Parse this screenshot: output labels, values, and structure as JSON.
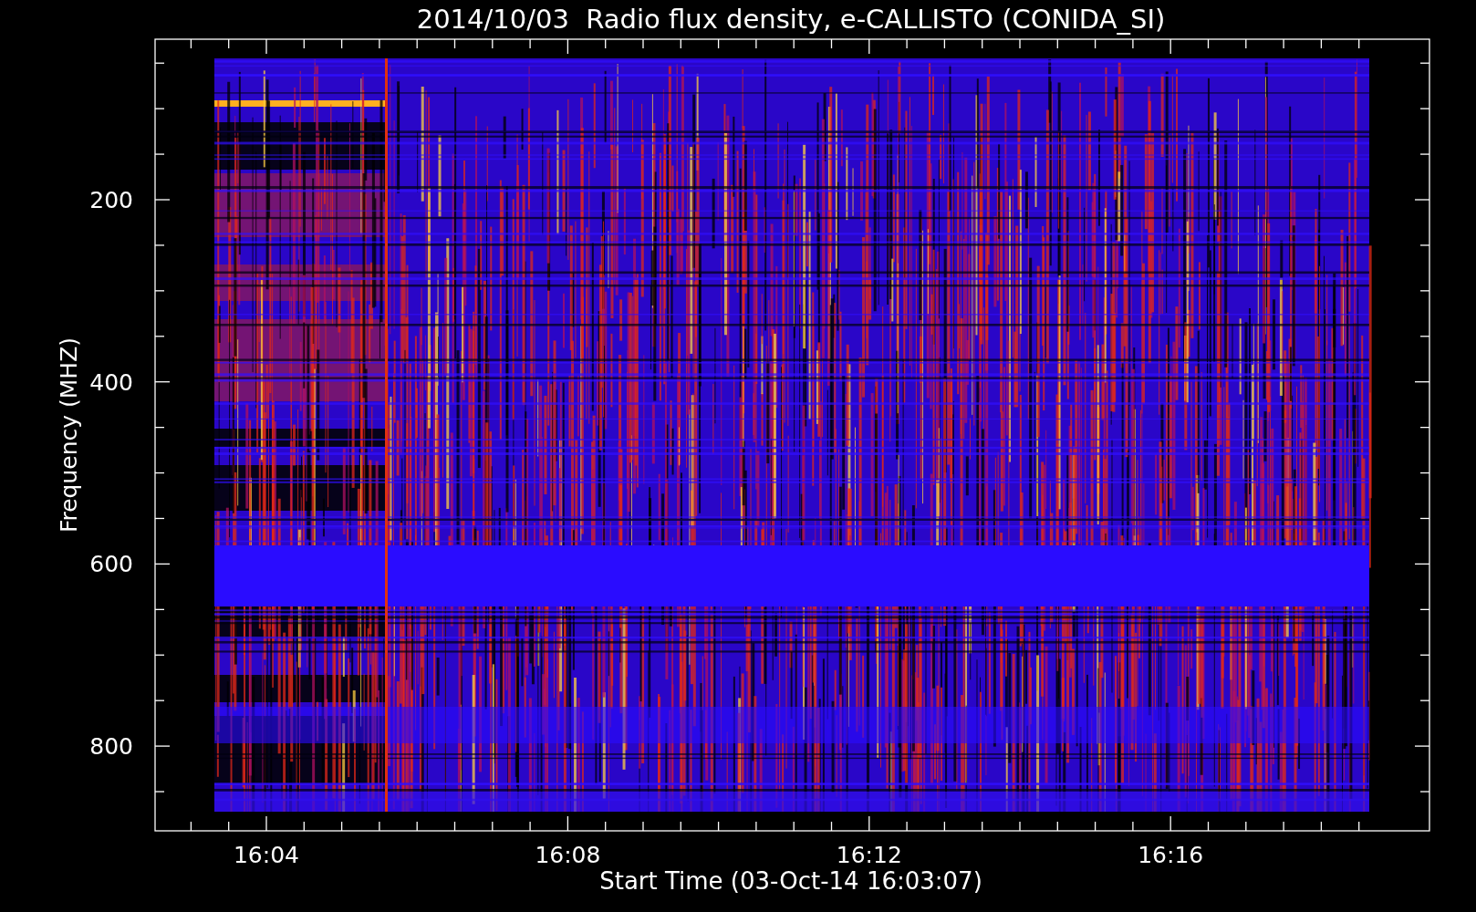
{
  "title": "2014/10/03  Radio flux density, e-CALLISTO (CONIDA_SI)",
  "y_axis": {
    "label": "Frequency (MHZ)",
    "ticks": [
      "200",
      "400",
      "600",
      "800"
    ]
  },
  "x_axis": {
    "label": "Start Time (03-Oct-14 16:03:07)",
    "ticks": [
      "16:04",
      "16:08",
      "16:12",
      "16:16"
    ]
  }
}
